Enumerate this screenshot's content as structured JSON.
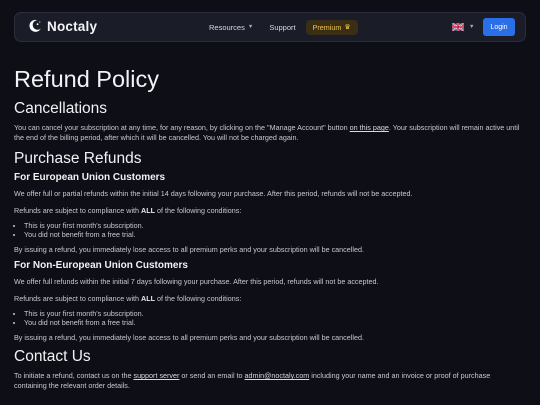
{
  "nav": {
    "brand": "Noctaly",
    "resources": "Resources",
    "support": "Support",
    "premium": "Premium",
    "login": "Login"
  },
  "page": {
    "title": "Refund Policy",
    "cancellations": {
      "heading": "Cancellations",
      "text_before": "You can cancel your subscription at any time, for any reason, by clicking on the \"Manage Account\" button ",
      "link": "on this page",
      "text_after": ". Your subscription will remain active until the end of the billing period, after which it will be cancelled. You will not be charged again."
    },
    "refunds": {
      "heading": "Purchase Refunds",
      "eu": {
        "heading": "For European Union Customers",
        "p1": "We offer full or partial refunds within the initial 14 days following your purchase. After this period, refunds will not be accepted.",
        "p2_before": "Refunds are subject to compliance with ",
        "p2_bold": "ALL",
        "p2_after": " of the following conditions:",
        "items": [
          "This is your first month's subscription.",
          "You did not benefit from a free trial."
        ],
        "p3": "By issuing a refund, you immediately lose access to all premium perks and your subscription will be cancelled."
      },
      "non_eu": {
        "heading": "For Non-European Union Customers",
        "p1": "We offer full refunds within the initial 7 days following your purchase. After this period, refunds will not be accepted.",
        "p2_before": "Refunds are subject to compliance with ",
        "p2_bold": "ALL",
        "p2_after": " of the following conditions:",
        "items": [
          "This is your first month's subscription.",
          "You did not benefit from a free trial."
        ],
        "p3": "By issuing a refund, you immediately lose access to all premium perks and your subscription will be cancelled."
      }
    },
    "contact": {
      "heading": "Contact Us",
      "text1": "To initiate a refund, contact us on the ",
      "link1": "support server",
      "text2": " or send an email to ",
      "link2": "admin@noctaly.com",
      "text3": " including your name and an invoice or proof of purchase containing the relevant order details."
    }
  },
  "icons": {
    "brand": "moon-logo-icon",
    "premium": "crown-icon",
    "language": "uk-flag-icon"
  },
  "colors": {
    "background": "#0d0e16",
    "navbar": "#1a1c28",
    "accent": "#2a6ee8",
    "premium_text": "#f0c451",
    "premium_bg": "#3a2f14"
  }
}
